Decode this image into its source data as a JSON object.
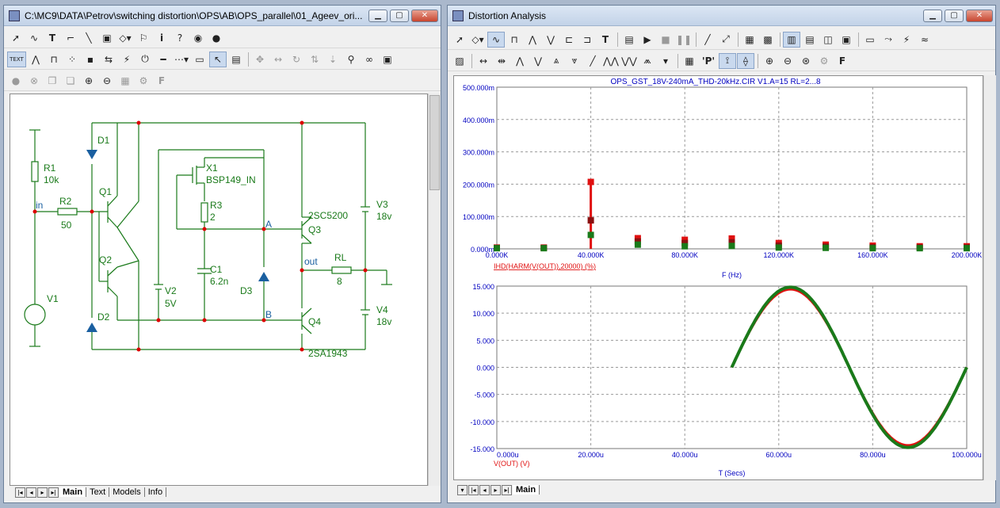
{
  "schematic_window": {
    "title": "C:\\MC9\\DATA\\Petrov\\switching distortion\\OPS\\AB\\OPS_parallel\\01_Ageev_ori...",
    "tabs": [
      "Main",
      "Text",
      "Models",
      "Info"
    ],
    "text_mode_label": "TEXT",
    "components": {
      "R1": {
        "name": "R1",
        "value": "10k"
      },
      "R2": {
        "name": "R2",
        "value": "50"
      },
      "R3": {
        "name": "R3",
        "value": "2"
      },
      "RL": {
        "name": "RL",
        "value": "8"
      },
      "C1": {
        "name": "C1",
        "value": "6.2n"
      },
      "X1": {
        "name": "X1",
        "value": "BSP149_IN"
      },
      "Q1": {
        "name": "Q1"
      },
      "Q2": {
        "name": "Q2"
      },
      "Q3": {
        "name": "Q3",
        "value": "2SC5200"
      },
      "Q4": {
        "name": "Q4",
        "value": "2SA1943"
      },
      "D1": {
        "name": "D1"
      },
      "D2": {
        "name": "D2"
      },
      "D3": {
        "name": "D3"
      },
      "V1": {
        "name": "V1"
      },
      "V2": {
        "name": "V2",
        "value": "5V"
      },
      "V3": {
        "name": "V3",
        "value": "18v"
      },
      "V4": {
        "name": "V4",
        "value": "18v"
      }
    },
    "node_labels": {
      "in": "in",
      "out": "out",
      "A": "A",
      "B": "B"
    }
  },
  "analysis_window": {
    "title": "Distortion Analysis",
    "tabs": [
      "Main"
    ],
    "P_button": "'P'",
    "F_button": "F",
    "plot_title": "OPS_GST_18V-240mA_THD-20kHz.CIR V1.A=15 RL=2...8",
    "colors": {
      "red": "#e01010",
      "green": "#1a7a1a",
      "darkred": "#8a1010",
      "axis_blue": "#0000c0",
      "grid": "#999999"
    }
  },
  "chart_data": [
    {
      "type": "bar",
      "title": "OPS_GST_18V-240mA_THD-20kHz.CIR V1.A=15 RL=2...8",
      "xlabel": "F (Hz)",
      "ylabel": "",
      "series_label": "IHD(HARM(V(OUT)),20000) (%)",
      "xlim": [
        0,
        200000
      ],
      "ylim": [
        0,
        0.5
      ],
      "x_ticks": [
        "0.000K",
        "40.000K",
        "80.000K",
        "120.000K",
        "160.000K",
        "200.000K"
      ],
      "y_ticks": [
        "0.000m",
        "100.000m",
        "200.000m",
        "300.000m",
        "400.000m",
        "500.000m"
      ],
      "grid": true,
      "x": [
        0,
        20000,
        40000,
        60000,
        80000,
        100000,
        120000,
        140000,
        160000,
        180000,
        200000
      ],
      "series": [
        {
          "color": "red",
          "values": [
            0.004,
            0.004,
            0.207,
            0.033,
            0.028,
            0.032,
            0.018,
            0.013,
            0.01,
            0.008,
            0.008
          ]
        },
        {
          "color": "darkred",
          "values": [
            0.003,
            0.003,
            0.088,
            0.023,
            0.018,
            0.02,
            0.01,
            0.007,
            0.005,
            0.004,
            0.004
          ]
        },
        {
          "color": "green",
          "values": [
            0.002,
            0.002,
            0.043,
            0.013,
            0.008,
            0.009,
            0.004,
            0.003,
            0.002,
            0.002,
            0.002
          ]
        }
      ]
    },
    {
      "type": "line",
      "xlabel": "T (Secs)",
      "ylabel": "",
      "series_label": "V(OUT) (V)",
      "xlim": [
        0,
        100
      ],
      "ylim": [
        -15,
        15
      ],
      "x_ticks": [
        "0.000u",
        "20.000u",
        "40.000u",
        "60.000u",
        "80.000u",
        "100.000u"
      ],
      "y_ticks": [
        "15.000",
        "10.000",
        "5.000",
        "0.000",
        "-5.000",
        "-10.000",
        "-15.000"
      ],
      "grid": true,
      "x_start": 50,
      "x_end": 100,
      "period": 50,
      "series": [
        {
          "color": "red",
          "amplitude": 14.4
        },
        {
          "color": "green",
          "amplitude": 14.8
        }
      ]
    }
  ]
}
